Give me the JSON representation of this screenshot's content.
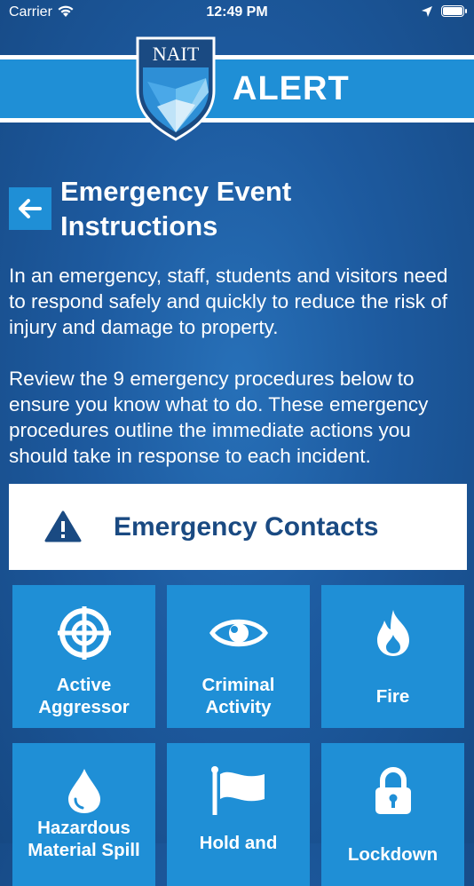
{
  "status_bar": {
    "carrier": "Carrier",
    "time": "12:49 PM"
  },
  "header": {
    "logo_text": "NAIT",
    "banner_title": "ALERT"
  },
  "page": {
    "title": "Emergency Event Instructions",
    "intro_paragraphs": [
      "In an emergency, staff, students and visitors need to respond safely and quickly to reduce the risk of injury and damage to property.",
      "Review the 9 emergency procedures below to ensure you know what to do. These emergency procedures outline the immediate actions you should take in response to each incident."
    ]
  },
  "contacts": {
    "label": "Emergency Contacts",
    "icon": "warning-icon"
  },
  "procedures": [
    {
      "label_lines": [
        "Active",
        "Aggressor"
      ],
      "icon": "crosshair-icon"
    },
    {
      "label_lines": [
        "Criminal",
        "Activity"
      ],
      "icon": "eye-icon"
    },
    {
      "label_lines": [
        "Fire"
      ],
      "icon": "flame-icon"
    },
    {
      "label_lines": [
        "Hazardous",
        "Material Spill"
      ],
      "icon": "droplet-icon"
    },
    {
      "label_lines": [
        "Hold and",
        ""
      ],
      "icon": "flag-icon"
    },
    {
      "label_lines": [
        "Lockdown"
      ],
      "icon": "lock-icon"
    }
  ],
  "colors": {
    "background": "#1d5a9f",
    "accent": "#1f8fd6",
    "contacts_text": "#1a4a82"
  }
}
